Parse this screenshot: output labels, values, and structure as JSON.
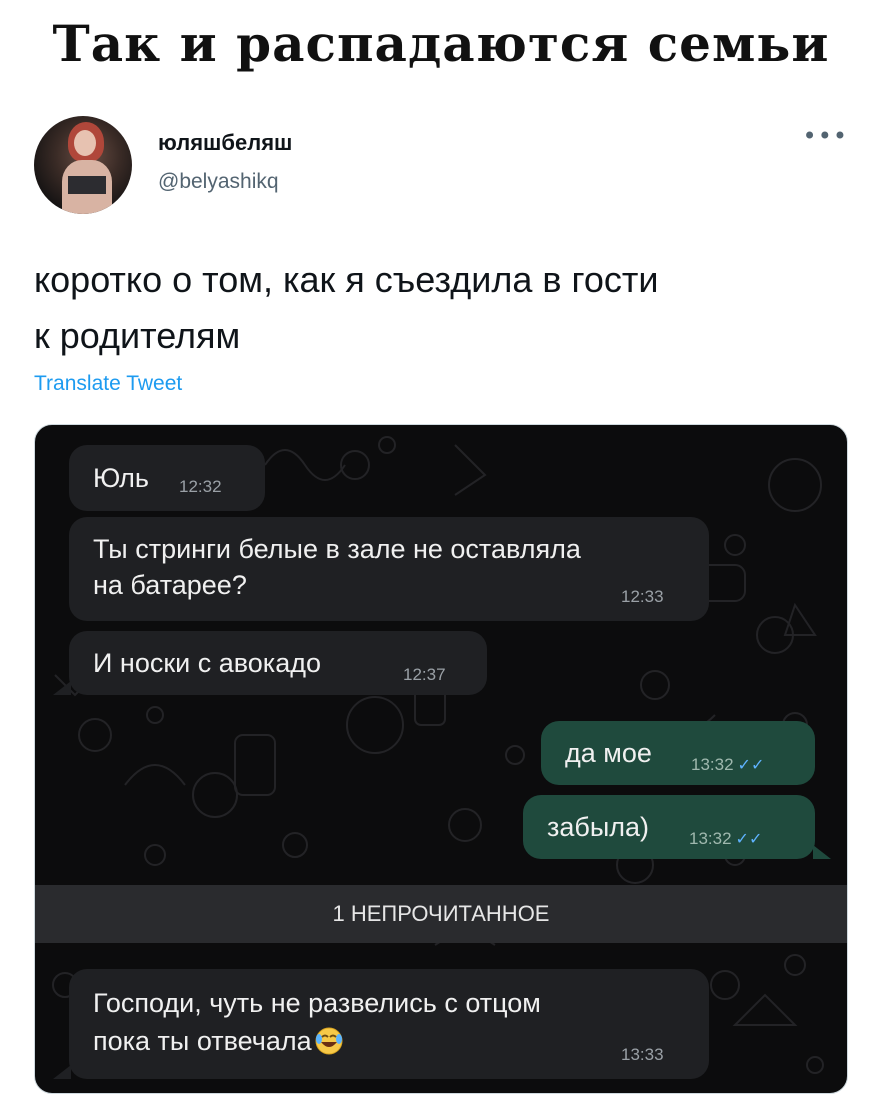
{
  "caption": "Так и распадаются семьи",
  "tweet": {
    "display_name": "юляшбеляш",
    "handle": "@belyashikq",
    "more_label": "•••",
    "text_line1": "коротко о том, как я съездила в гости",
    "text_line2": "к родителям",
    "translate": "Translate Tweet"
  },
  "chat": {
    "messages": [
      {
        "text": "Юль",
        "time": "12:32"
      },
      {
        "text1": "Ты стринги белые в зале не оставляла",
        "text2": "на батарее?",
        "time": "12:33"
      },
      {
        "text": "И носки с авокадо",
        "time": "12:37"
      },
      {
        "text": "да мое",
        "time": "13:32"
      },
      {
        "text": "забыла)",
        "time": "13:32"
      },
      {
        "text1": "Господи, чуть не развелись с отцом",
        "text2": "пока ты отвечала",
        "time": "13:33"
      }
    ],
    "unread_label": "1 НЕПРОЧИТАННОЕ",
    "read_checks": "✓✓"
  },
  "colors": {
    "chat_bg": "#0c0c0d",
    "incoming_bubble": "#1f2023",
    "outgoing_bubble": "#1f4a3d",
    "link_blue": "#1d9bf0",
    "read_tick_blue": "#5fb3ff"
  },
  "icons": {
    "more": "more-horizontal-icon",
    "read_receipt": "double-check-icon",
    "emoji": "laughing-tears-emoji"
  }
}
